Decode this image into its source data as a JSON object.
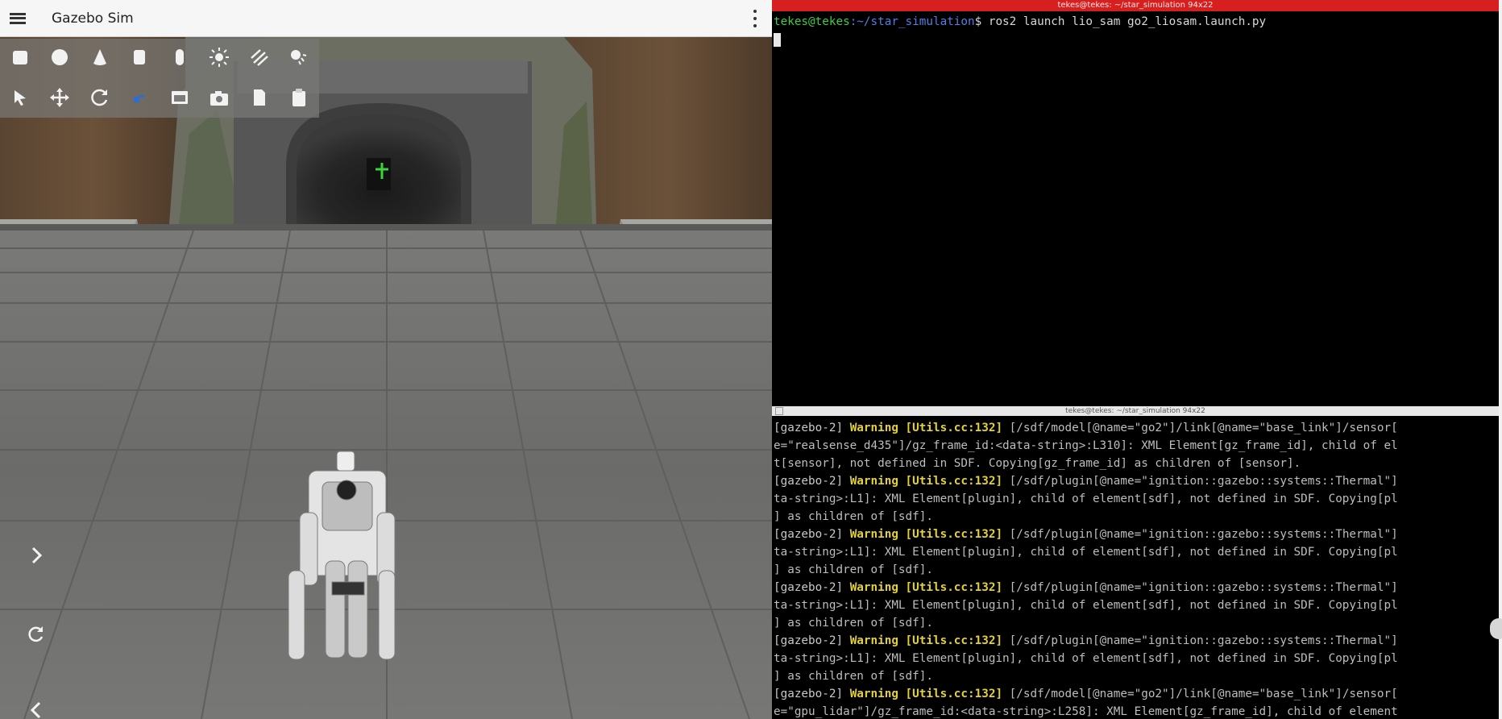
{
  "gazebo": {
    "title": "Gazebo Sim",
    "toolbar_row1": [
      "box-icon",
      "sphere-icon",
      "cone-icon",
      "cylinder-icon",
      "capsule-icon",
      "sun-icon",
      "directional-light-icon",
      "spot-light-icon"
    ],
    "toolbar_row2": [
      "select-icon",
      "translate-icon",
      "rotate-icon",
      "snap-icon",
      "screenshot-view-icon",
      "camera-icon",
      "copy-icon",
      "paste-icon"
    ]
  },
  "terminal_top": {
    "title": "tekes@tekes: ~/star_simulation 94x22",
    "prompt_user": "tekes@tekes",
    "prompt_path": ":~/star_simulation",
    "prompt_symbol": "$",
    "command": " ros2 launch lio_sam go2_liosam.launch.py"
  },
  "terminal_bottom": {
    "title": "tekes@tekes: ~/star_simulation 94x22",
    "log": [
      {
        "tag": "[gazebo-2] ",
        "level": "Warning [Utils.cc:132]",
        "text": " [/sdf/model[@name=\"go2\"]/link[@name=\"base_link\"]/sensor["
      },
      {
        "tag": "",
        "level": "",
        "text": "e=\"realsense_d435\"]/gz_frame_id:<data-string>:L310]: XML Element[gz_frame_id], child of el"
      },
      {
        "tag": "",
        "level": "",
        "text": "t[sensor], not defined in SDF. Copying[gz_frame_id] as children of [sensor]."
      },
      {
        "tag": "[gazebo-2] ",
        "level": "Warning [Utils.cc:132]",
        "text": " [/sdf/plugin[@name=\"ignition::gazebo::systems::Thermal\"]"
      },
      {
        "tag": "",
        "level": "",
        "text": "ta-string>:L1]: XML Element[plugin], child of element[sdf], not defined in SDF. Copying[pl"
      },
      {
        "tag": "",
        "level": "",
        "text": "] as children of [sdf]."
      },
      {
        "tag": "[gazebo-2] ",
        "level": "Warning [Utils.cc:132]",
        "text": " [/sdf/plugin[@name=\"ignition::gazebo::systems::Thermal\"]"
      },
      {
        "tag": "",
        "level": "",
        "text": "ta-string>:L1]: XML Element[plugin], child of element[sdf], not defined in SDF. Copying[pl"
      },
      {
        "tag": "",
        "level": "",
        "text": "] as children of [sdf]."
      },
      {
        "tag": "[gazebo-2] ",
        "level": "Warning [Utils.cc:132]",
        "text": " [/sdf/plugin[@name=\"ignition::gazebo::systems::Thermal\"]"
      },
      {
        "tag": "",
        "level": "",
        "text": "ta-string>:L1]: XML Element[plugin], child of element[sdf], not defined in SDF. Copying[pl"
      },
      {
        "tag": "",
        "level": "",
        "text": "] as children of [sdf]."
      },
      {
        "tag": "[gazebo-2] ",
        "level": "Warning [Utils.cc:132]",
        "text": " [/sdf/plugin[@name=\"ignition::gazebo::systems::Thermal\"]"
      },
      {
        "tag": "",
        "level": "",
        "text": "ta-string>:L1]: XML Element[plugin], child of element[sdf], not defined in SDF. Copying[pl"
      },
      {
        "tag": "",
        "level": "",
        "text": "] as children of [sdf]."
      },
      {
        "tag": "[gazebo-2] ",
        "level": "Warning [Utils.cc:132]",
        "text": " [/sdf/model[@name=\"go2\"]/link[@name=\"base_link\"]/sensor["
      },
      {
        "tag": "",
        "level": "",
        "text": "e=\"gpu_lidar\"]/gz_frame_id:<data-string>:L258]: XML Element[gz_frame_id], child of element"
      }
    ]
  },
  "colors": {
    "terminal_top_titlebar": "#d71f1f",
    "prompt_user": "#3fce3f",
    "prompt_path": "#4f7fe9",
    "warning": "#e3d22f"
  }
}
